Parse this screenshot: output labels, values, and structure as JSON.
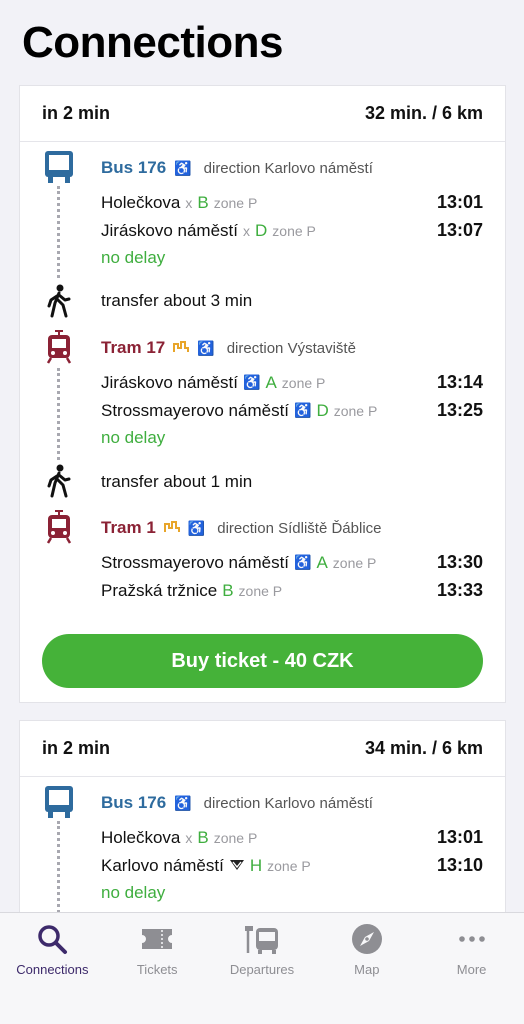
{
  "header": {
    "title": "Connections"
  },
  "connections": [
    {
      "depart": "in 2 min",
      "summary": "32 min. / 6 km",
      "legs": [
        {
          "line": "Bus 176",
          "direction": "direction Karlovo náměstí",
          "stops": [
            {
              "name": "Holečkova",
              "sep": "x",
              "platform": "B",
              "zone": "zone P",
              "time": "13:01"
            },
            {
              "name": "Jiráskovo náměstí",
              "sep": "x",
              "platform": "D",
              "zone": "zone P",
              "time": "13:07"
            }
          ],
          "status": "no delay"
        },
        {
          "transfer": "transfer about 3 min"
        },
        {
          "line": "Tram 17",
          "direction": "direction Výstaviště",
          "stops": [
            {
              "name": "Jiráskovo náměstí",
              "platform": "A",
              "zone": "zone P",
              "time": "13:14"
            },
            {
              "name": "Strossmayerovo náměstí",
              "platform": "D",
              "zone": "zone P",
              "time": "13:25"
            }
          ],
          "status": "no delay"
        },
        {
          "transfer": "transfer about 1 min"
        },
        {
          "line": "Tram 1",
          "direction": "direction Sídliště Ďáblice",
          "stops": [
            {
              "name": "Strossmayerovo náměstí",
              "platform": "A",
              "zone": "zone P",
              "time": "13:30"
            },
            {
              "name": "Pražská tržnice",
              "platform": "B",
              "zone": "zone P",
              "time": "13:33"
            }
          ]
        }
      ],
      "buy_label": "Buy ticket - 40 CZK"
    },
    {
      "depart": "in 2 min",
      "summary": "34 min. / 6 km",
      "legs": [
        {
          "line": "Bus 176",
          "direction": "direction Karlovo náměstí",
          "stops": [
            {
              "name": "Holečkova",
              "sep": "x",
              "platform": "B",
              "zone": "zone P",
              "time": "13:01"
            },
            {
              "name": "Karlovo náměstí",
              "platform": "H",
              "zone": "zone P",
              "time": "13:10"
            }
          ],
          "status": "no delay"
        }
      ]
    }
  ],
  "icons": {
    "bus": "bus-icon",
    "tram": "tram-icon",
    "walk": "walking-person-icon",
    "wheelchair": "wheelchair-icon",
    "night": "night-tram-icon",
    "metro": "metro-icon"
  },
  "colors": {
    "bus": "#2e6b9e",
    "tram": "#8b2235",
    "platform": "#3fae3f",
    "button": "#45b239",
    "active_tab": "#3d2a6b"
  },
  "tabbar": {
    "items": [
      {
        "label": "Connections",
        "icon": "search-icon",
        "active": true
      },
      {
        "label": "Tickets",
        "icon": "ticket-icon"
      },
      {
        "label": "Departures",
        "icon": "departures-icon"
      },
      {
        "label": "Map",
        "icon": "compass-icon"
      },
      {
        "label": "More",
        "icon": "more-icon"
      }
    ]
  }
}
